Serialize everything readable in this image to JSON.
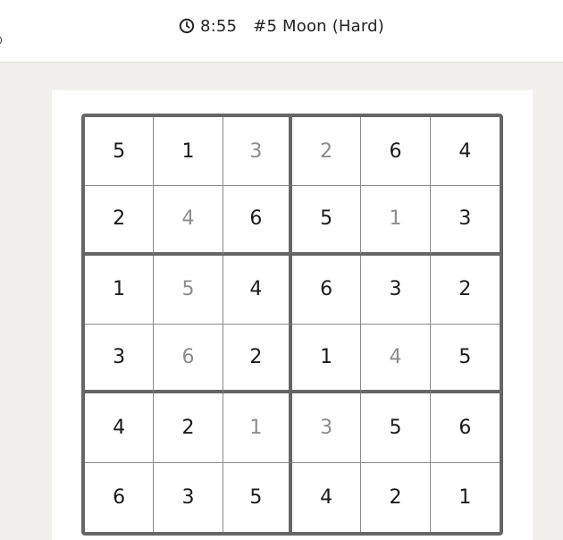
{
  "header": {
    "timer": "8:55",
    "puzzle_title": "#5 Moon (Hard)"
  },
  "board": {
    "rows": [
      [
        {
          "v": "5",
          "t": "given"
        },
        {
          "v": "1",
          "t": "given"
        },
        {
          "v": "3",
          "t": "entered"
        },
        {
          "v": "2",
          "t": "entered"
        },
        {
          "v": "6",
          "t": "given"
        },
        {
          "v": "4",
          "t": "given"
        }
      ],
      [
        {
          "v": "2",
          "t": "given"
        },
        {
          "v": "4",
          "t": "entered"
        },
        {
          "v": "6",
          "t": "given"
        },
        {
          "v": "5",
          "t": "given"
        },
        {
          "v": "1",
          "t": "entered"
        },
        {
          "v": "3",
          "t": "given"
        }
      ],
      [
        {
          "v": "1",
          "t": "given"
        },
        {
          "v": "5",
          "t": "entered"
        },
        {
          "v": "4",
          "t": "given"
        },
        {
          "v": "6",
          "t": "given"
        },
        {
          "v": "3",
          "t": "given"
        },
        {
          "v": "2",
          "t": "given"
        }
      ],
      [
        {
          "v": "3",
          "t": "given"
        },
        {
          "v": "6",
          "t": "entered"
        },
        {
          "v": "2",
          "t": "given"
        },
        {
          "v": "1",
          "t": "given"
        },
        {
          "v": "4",
          "t": "entered"
        },
        {
          "v": "5",
          "t": "given"
        }
      ],
      [
        {
          "v": "4",
          "t": "given"
        },
        {
          "v": "2",
          "t": "given"
        },
        {
          "v": "1",
          "t": "entered"
        },
        {
          "v": "3",
          "t": "entered"
        },
        {
          "v": "5",
          "t": "given"
        },
        {
          "v": "6",
          "t": "given"
        }
      ],
      [
        {
          "v": "6",
          "t": "given"
        },
        {
          "v": "3",
          "t": "given"
        },
        {
          "v": "5",
          "t": "given"
        },
        {
          "v": "4",
          "t": "given"
        },
        {
          "v": "2",
          "t": "given"
        },
        {
          "v": "1",
          "t": "given"
        }
      ]
    ]
  },
  "colors": {
    "given_digit": "#1a1a1a",
    "entered_digit": "#8c8c8c",
    "box_border": "#666666",
    "background": "#f1f0ed"
  }
}
